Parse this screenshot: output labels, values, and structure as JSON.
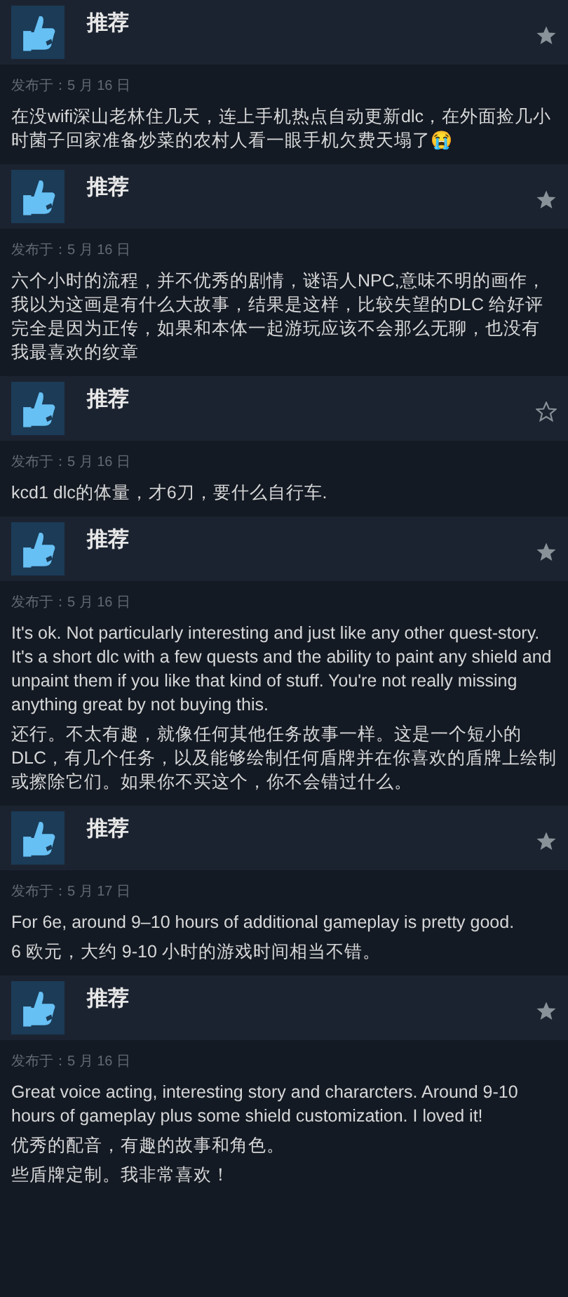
{
  "reviews": [
    {
      "title": "推荐",
      "starred": true,
      "date": "发布于：5 月 16 日",
      "paragraphs": [
        "在没wifi深山老林住几天，连上手机热点自动更新dlc，在外面捡几小时菌子回家准备炒菜的农村人看一眼手机欠费天塌了😭"
      ]
    },
    {
      "title": "推荐",
      "starred": true,
      "date": "发布于：5 月 16 日",
      "paragraphs": [
        "六个小时的流程，并不优秀的剧情，谜语人NPC,意味不明的画作，我以为这画是有什么大故事，结果是这样，比较失望的DLC 给好评完全是因为正传，如果和本体一起游玩应该不会那么无聊，也没有我最喜欢的纹章"
      ]
    },
    {
      "title": "推荐",
      "starred": false,
      "date": "发布于：5 月 16 日",
      "paragraphs": [
        "kcd1 dlc的体量，才6刀，要什么自行车."
      ]
    },
    {
      "title": "推荐",
      "starred": true,
      "date": "发布于：5 月 16 日",
      "paragraphs": [
        "It's ok. Not particularly interesting and just like any other quest-story. It's a short dlc with a few quests and the ability to paint any shield and unpaint them if you like that kind of stuff. You're not really missing anything great by not buying this.",
        "还行。不太有趣，就像任何其他任务故事一样。这是一个短小的DLC，有几个任务，以及能够绘制任何盾牌并在你喜欢的盾牌上绘制或擦除它们。如果你不买这个，你不会错过什么。"
      ]
    },
    {
      "title": "推荐",
      "starred": true,
      "date": "发布于：5 月 17 日",
      "paragraphs": [
        "For 6e, around 9–10 hours of additional gameplay is pretty good.",
        "6 欧元，大约 9-10 小时的游戏时间相当不错。"
      ]
    },
    {
      "title": "推荐",
      "starred": true,
      "date": "发布于：5 月 16 日",
      "paragraphs": [
        "Great voice acting, interesting story and chararcters. Around 9-10 hours of gameplay plus some shield customization. I loved it!",
        "优秀的配音，有趣的故事和角色。",
        "些盾牌定制。我非常喜欢！"
      ]
    }
  ]
}
